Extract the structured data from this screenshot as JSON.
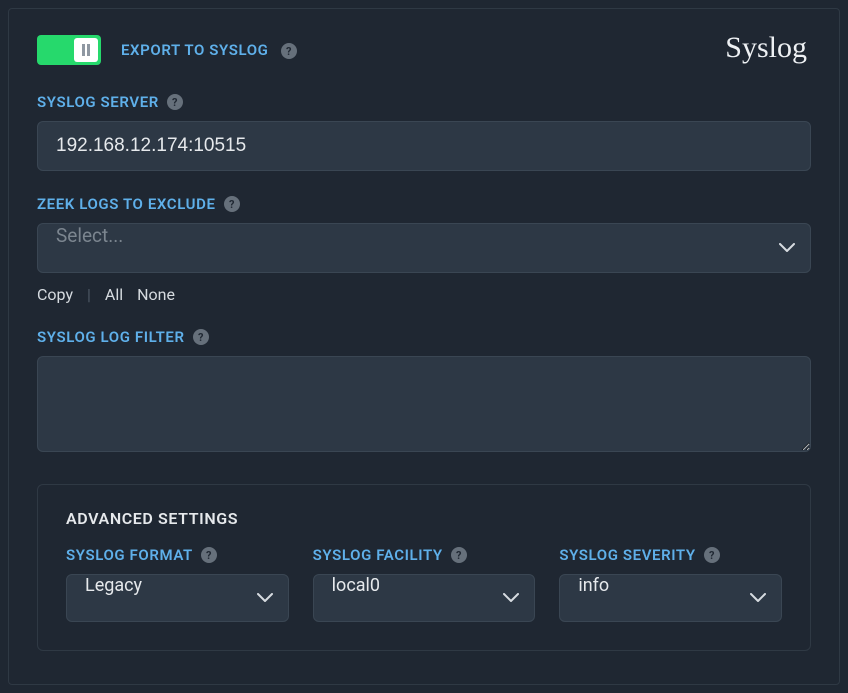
{
  "page_title": "Syslog",
  "toggle": {
    "label": "EXPORT TO SYSLOG",
    "on": true
  },
  "server": {
    "label": "SYSLOG SERVER",
    "value": "192.168.12.174:10515"
  },
  "exclude": {
    "label": "ZEEK LOGS TO EXCLUDE",
    "placeholder": "Select...",
    "quicklinks": {
      "copy": "Copy",
      "all": "All",
      "none": "None"
    }
  },
  "filter": {
    "label": "SYSLOG LOG FILTER",
    "value": ""
  },
  "advanced": {
    "title": "ADVANCED SETTINGS",
    "format": {
      "label": "SYSLOG FORMAT",
      "value": "Legacy"
    },
    "facility": {
      "label": "SYSLOG FACILITY",
      "value": "local0"
    },
    "severity": {
      "label": "SYSLOG SEVERITY",
      "value": "info"
    }
  }
}
